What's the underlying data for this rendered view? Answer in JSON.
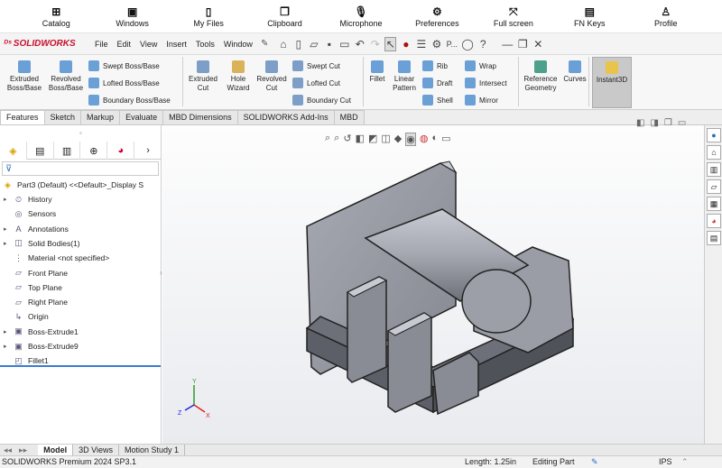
{
  "remote_toolbar": [
    {
      "label": "Catalog",
      "icon": "plus-box-icon"
    },
    {
      "label": "Windows",
      "icon": "window-icon"
    },
    {
      "label": "My Files",
      "icon": "file-icon"
    },
    {
      "label": "Clipboard",
      "icon": "clipboard-icon"
    },
    {
      "label": "Microphone",
      "icon": "microphone-icon"
    },
    {
      "label": "Preferences",
      "icon": "gear-icon"
    },
    {
      "label": "Full screen",
      "icon": "fullscreen-icon"
    },
    {
      "label": "FN Keys",
      "icon": "keyboard-icon"
    },
    {
      "label": "Profile",
      "icon": "person-icon"
    }
  ],
  "app": {
    "logo": "SOLIDWORKS"
  },
  "menu": [
    "File",
    "Edit",
    "View",
    "Insert",
    "Tools",
    "Window"
  ],
  "quick_access_more": "P...",
  "ribbon": {
    "extruded_boss": "Extruded Boss/Base",
    "revolved_boss": "Revolved Boss/Base",
    "swept_boss": "Swept Boss/Base",
    "lofted_boss": "Lofted Boss/Base",
    "boundary_boss": "Boundary Boss/Base",
    "extruded_cut": "Extruded Cut",
    "hole_wizard": "Hole Wizard",
    "revolved_cut": "Revolved Cut",
    "swept_cut": "Swept Cut",
    "lofted_cut": "Lofted Cut",
    "boundary_cut": "Boundary Cut",
    "fillet": "Fillet",
    "linear_pattern": "Linear Pattern",
    "rib": "Rib",
    "draft": "Draft",
    "shell": "Shell",
    "wrap": "Wrap",
    "intersect": "Intersect",
    "mirror": "Mirror",
    "reference_geometry": "Reference Geometry",
    "curves": "Curves",
    "instant3d": "Instant3D"
  },
  "command_tabs": [
    "Features",
    "Sketch",
    "Markup",
    "Evaluate",
    "MBD Dimensions",
    "SOLIDWORKS Add-Ins",
    "MBD"
  ],
  "tree": {
    "root": "Part3 (Default) <<Default>_Display S",
    "items": [
      {
        "label": "History",
        "expandable": true
      },
      {
        "label": "Sensors",
        "expandable": false
      },
      {
        "label": "Annotations",
        "expandable": true
      },
      {
        "label": "Solid Bodies(1)",
        "expandable": true
      },
      {
        "label": "Material <not specified>",
        "expandable": false
      },
      {
        "label": "Front Plane",
        "expandable": false
      },
      {
        "label": "Top Plane",
        "expandable": false
      },
      {
        "label": "Right Plane",
        "expandable": false
      },
      {
        "label": "Origin",
        "expandable": false
      },
      {
        "label": "Boss-Extrude1",
        "expandable": true
      },
      {
        "label": "Boss-Extrude9",
        "expandable": true
      },
      {
        "label": "Fillet1",
        "expandable": false
      }
    ]
  },
  "bottom_tabs": [
    "Model",
    "3D Views",
    "Motion Study 1"
  ],
  "status": {
    "product": "SOLIDWORKS Premium 2024 SP3.1",
    "length": "Length: 1.25in",
    "mode": "Editing Part",
    "units": "IPS"
  },
  "colors": {
    "logo_red": "#c8102e",
    "part_gray": "#8e9099"
  }
}
